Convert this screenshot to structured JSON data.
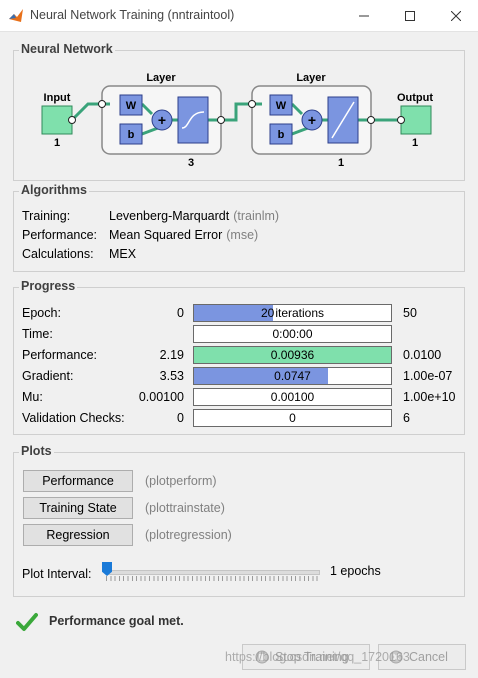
{
  "window": {
    "title": "Neural Network Training (nntraintool)"
  },
  "network": {
    "title": "Neural Network",
    "input": {
      "label": "Input",
      "size": "1"
    },
    "layer1": {
      "label": "Layer",
      "size": "3"
    },
    "layer2": {
      "label": "Layer",
      "size": "1"
    },
    "output": {
      "label": "Output",
      "size": "1"
    },
    "w": "W",
    "b": "b",
    "plus": "+"
  },
  "algorithms": {
    "title": "Algorithms",
    "rows": [
      {
        "label": "Training:",
        "value": "Levenberg-Marquardt",
        "note": "(trainlm)"
      },
      {
        "label": "Performance:",
        "value": "Mean Squared Error",
        "note": "(mse)"
      },
      {
        "label": "Calculations:",
        "value": "MEX",
        "note": ""
      }
    ]
  },
  "progress": {
    "title": "Progress",
    "rows": [
      {
        "label": "Epoch:",
        "start": "0",
        "bar": "20",
        "bar_suffix": "iterations",
        "end": "50",
        "fraction": 0.4,
        "color": "#7b95e0"
      },
      {
        "label": "Time:",
        "start": "",
        "bar": "0:00:00",
        "bar_suffix": "",
        "end": "",
        "fraction": 0,
        "color": "#7b95e0"
      },
      {
        "label": "Performance:",
        "start": "2.19",
        "bar": "0.00936",
        "bar_suffix": "",
        "end": "0.0100",
        "fraction": 1.0,
        "color": "#7fe0ac"
      },
      {
        "label": "Gradient:",
        "start": "3.53",
        "bar": "0.0747",
        "bar_suffix": "",
        "end": "1.00e-07",
        "fraction": 0.68,
        "color": "#7b95e0"
      },
      {
        "label": "Mu:",
        "start": "0.00100",
        "bar": "0.00100",
        "bar_suffix": "",
        "end": "1.00e+10",
        "fraction": 0,
        "color": "#7b95e0"
      },
      {
        "label": "Validation Checks:",
        "start": "0",
        "bar": "0",
        "bar_suffix": "",
        "end": "6",
        "fraction": 0,
        "color": "#7b95e0"
      }
    ]
  },
  "plots": {
    "title": "Plots",
    "buttons": [
      {
        "label": "Performance",
        "note": "(plotperform)"
      },
      {
        "label": "Training State",
        "note": "(plottrainstate)"
      },
      {
        "label": "Regression",
        "note": "(plotregression)"
      }
    ],
    "interval_label": "Plot Interval:",
    "interval_value": "1 epochs",
    "interval_fraction": 0
  },
  "status": {
    "message": "Performance goal met.",
    "icon": "check-icon"
  },
  "buttons": {
    "stop": "Stop Training",
    "cancel": "Cancel"
  },
  "watermark": "https://blog.csdn.net/qq_1720163"
}
